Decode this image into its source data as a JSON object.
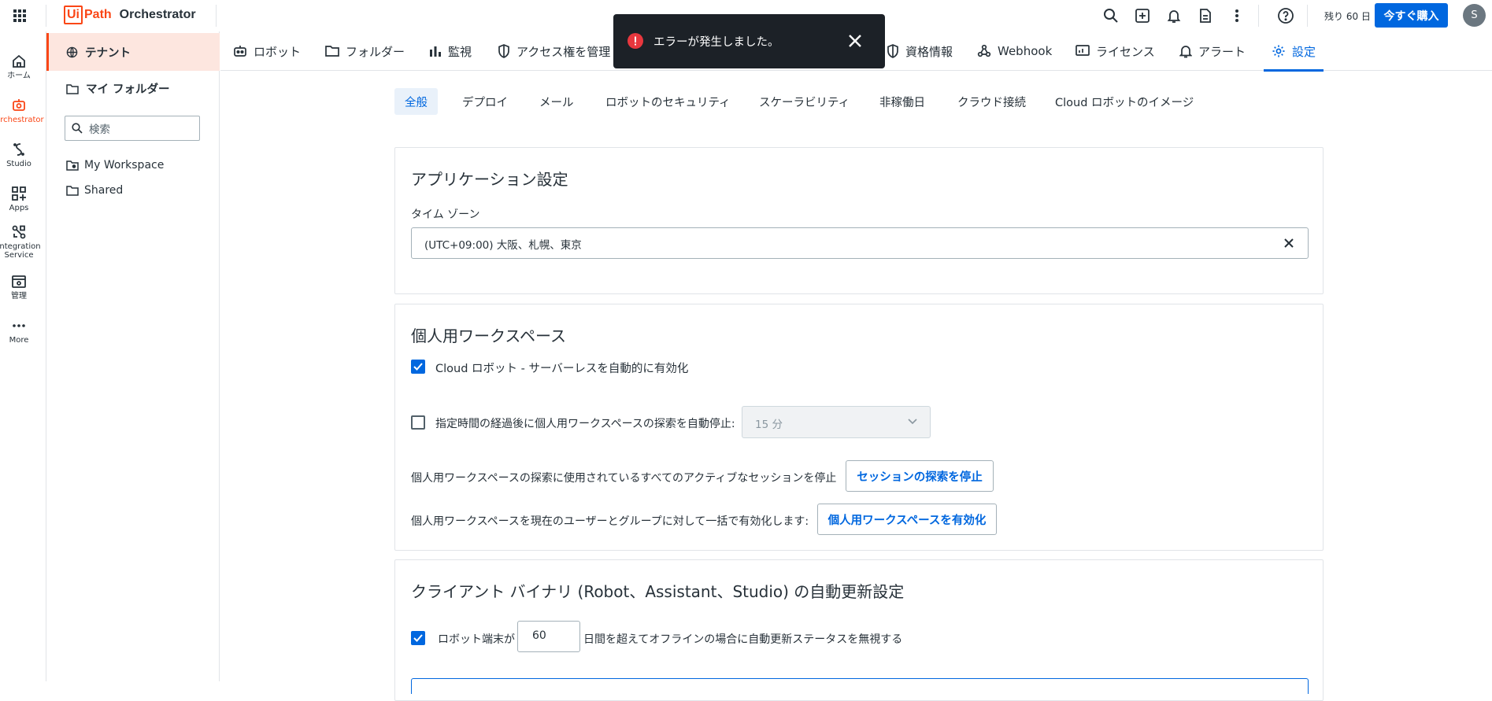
{
  "header": {
    "logo_box": "Ui",
    "logo_path": "Path",
    "product": "Orchestrator",
    "trial_days": "残り 60 日",
    "buy_button": "今すぐ購入",
    "avatar_initial": "S"
  },
  "rail": {
    "items": [
      {
        "label": "ホーム",
        "icon": "home-icon"
      },
      {
        "label": "Orchestrator",
        "icon": "orchestrator-icon"
      },
      {
        "label": "Studio",
        "icon": "studio-icon"
      },
      {
        "label": "Apps",
        "icon": "apps-icon"
      },
      {
        "label": "Integration Service",
        "line1": "Integration",
        "line2": "Service",
        "icon": "integration-icon"
      },
      {
        "label": "管理",
        "icon": "admin-icon"
      },
      {
        "label": "More",
        "icon": "more-icon"
      }
    ]
  },
  "folders": {
    "tenant": "テナント",
    "my_folders": "マイ フォルダー",
    "search_placeholder": "検索",
    "items": [
      "My Workspace",
      "Shared"
    ]
  },
  "tabs": [
    {
      "label": "ロボット",
      "icon": "robot-icon"
    },
    {
      "label": "フォルダー",
      "icon": "folder-icon"
    },
    {
      "label": "監視",
      "icon": "monitoring-icon"
    },
    {
      "label": "アクセス権を管理",
      "icon": "shield-icon"
    },
    {
      "label": "資格情報",
      "icon": "shield-icon"
    },
    {
      "label": "Webhook",
      "icon": "webhook-icon"
    },
    {
      "label": "ライセンス",
      "icon": "license-icon"
    },
    {
      "label": "アラート",
      "icon": "alert-bell-icon"
    },
    {
      "label": "設定",
      "icon": "gear-icon"
    }
  ],
  "subtabs": [
    "全般",
    "デプロイ",
    "メール",
    "ロボットのセキュリティ",
    "スケーラビリティ",
    "非稼働日",
    "クラウド接続",
    "Cloud ロボットのイメージ"
  ],
  "toast": {
    "message": "エラーが発生しました。"
  },
  "app_settings": {
    "title": "アプリケーション設定",
    "timezone_label": "タイム ゾーン",
    "timezone_value": "(UTC+09:00) 大阪、札幌、東京"
  },
  "personal_workspace": {
    "title": "個人用ワークスペース",
    "cloud_robot_checkbox": "Cloud ロボット - サーバーレスを自動的に有効化",
    "cloud_robot_checked": true,
    "auto_stop_checkbox": "指定時間の経過後に個人用ワークスペースの探索を自動停止:",
    "auto_stop_checked": false,
    "auto_stop_value": "15 分",
    "stop_sessions_text": "個人用ワークスペースの探索に使用されているすべてのアクティブなセッションを停止",
    "stop_sessions_button": "セッションの探索を停止",
    "enable_text": "個人用ワークスペースを現在のユーザーとグループに対して一括で有効化します:",
    "enable_button": "個人用ワークスペースを有効化"
  },
  "client_binaries": {
    "title": "クライアント バイナリ (Robot、Assistant、Studio) の自動更新設定",
    "checkbox_checked": true,
    "prefix": "ロボット端末が",
    "days_value": "60",
    "suffix": "日間を超えてオフラインの場合に自動更新ステータスを無視する"
  },
  "colors": {
    "accent": "#0067df",
    "brand": "#fa4616",
    "toast_bg": "#1c2127",
    "error": "#e8373e"
  }
}
